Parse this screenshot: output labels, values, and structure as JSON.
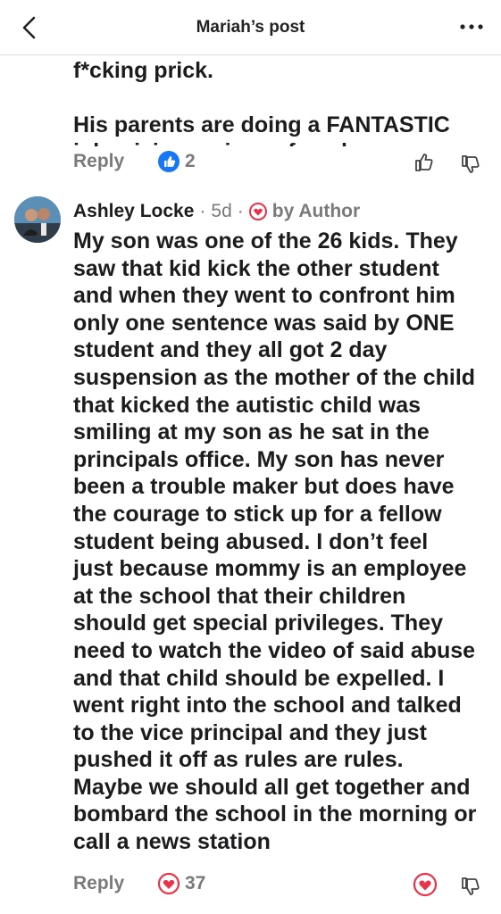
{
  "header": {
    "title": "Mariah’s post"
  },
  "previous_comment": {
    "cut_line": "f*cking prick.",
    "text": "His parents are doing a FANTASTIC\njob raising a piece of work......\nI'd love to talk to them. 🤣",
    "reply_label": "Reply",
    "reaction_count": "2",
    "reaction_color": "#1877f2"
  },
  "comment": {
    "author": "Ashley Locke",
    "time": "5d",
    "separator": "·",
    "badge_label": "by Author",
    "text": "My son was one of the 26 kids. They\nsaw that kid kick the other student\nand when they went to confront him\nonly one sentence was said by ONE\nstudent and they all got 2 day\nsuspension as the mother of the child\nthat kicked the autistic child was\nsmiling at my son as he sat in the\nprincipals office.  My son has never\nbeen a trouble maker but does have\nthe courage to stick up for a fellow\nstudent being abused.  I don’t feel\njust because mommy is an employee\nat the school that their children\nshould get special privileges. They\nneed to watch the video of said abuse\nand that child should be expelled. I\nwent right into the school and talked\nto the vice principal and they just\npushed it off as rules are rules.\nMaybe we should all get together and\nbombard the school in the morning or\ncall a news station",
    "reply_label": "Reply",
    "reaction_count": "37",
    "reaction_color": "#e8334a"
  }
}
